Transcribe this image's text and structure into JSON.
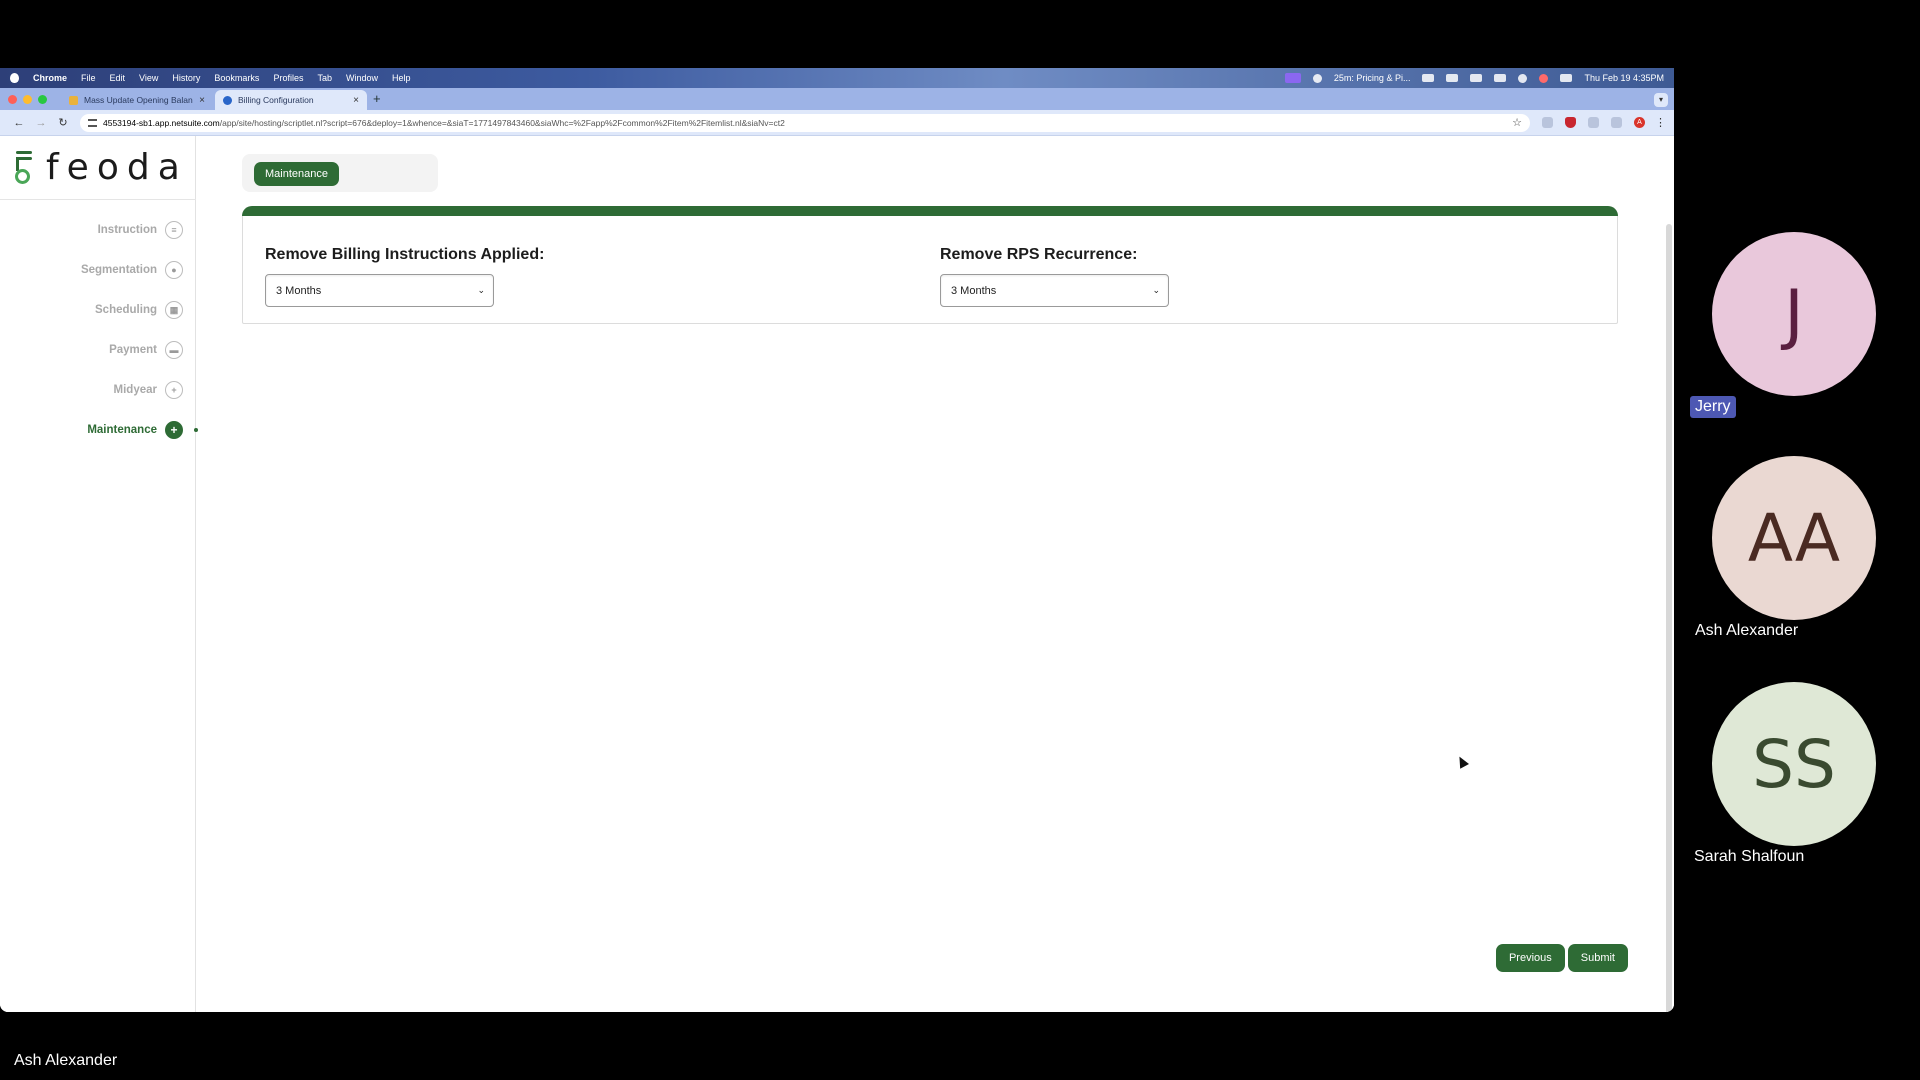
{
  "menubar": {
    "app": "Chrome",
    "items": [
      "File",
      "Edit",
      "View",
      "History",
      "Bookmarks",
      "Profiles",
      "Tab",
      "Window",
      "Help"
    ],
    "status_item": "25m: Pricing & Pi...",
    "clock": "Thu Feb 19  4:35PM"
  },
  "tabs": [
    {
      "label": "Mass Update Opening Balanc",
      "close": "×"
    },
    {
      "label": "Billing Configuration",
      "close": "×"
    }
  ],
  "new_tab": "+",
  "address": {
    "host": "4553194-sb1.app.netsuite.com",
    "path": "/app/site/hosting/scriptlet.nl?script=676&deploy=1&whence=&siaT=1771497843460&siaWhc=%2Fapp%2Fcommon%2Fitem%2Fitemlist.nl&siaNv=ct2"
  },
  "brand": {
    "logo_text": "feoda",
    "accent": "#2e6b35"
  },
  "sidebar": {
    "steps": [
      {
        "label": "Instruction",
        "icon": "list-icon",
        "glyph": "≡"
      },
      {
        "label": "Segmentation",
        "icon": "user-icon",
        "glyph": "●"
      },
      {
        "label": "Scheduling",
        "icon": "calendar-icon",
        "glyph": "▦"
      },
      {
        "label": "Payment",
        "icon": "card-icon",
        "glyph": "▬"
      },
      {
        "label": "Midyear",
        "icon": "plus-icon",
        "glyph": "+"
      },
      {
        "label": "Maintenance",
        "icon": "plus-icon",
        "glyph": "+",
        "active": true
      }
    ]
  },
  "main": {
    "section_pill": "Maintenance",
    "fields": [
      {
        "label": "Remove Billing Instructions Applied:",
        "value": "3 Months"
      },
      {
        "label": "Remove RPS Recurrence:",
        "value": "3 Months"
      }
    ],
    "buttons": {
      "previous": "Previous",
      "submit": "Submit"
    }
  },
  "participants": [
    {
      "initials": "J",
      "name": "Jerry",
      "bg": "#e9c8db",
      "fg": "#5a1f40"
    },
    {
      "initials": "AA",
      "name": "Ash Alexander",
      "bg": "#ead8d2",
      "fg": "#4a2a22"
    },
    {
      "initials": "SS",
      "name": "Sarah Shalfoun",
      "bg": "#dfe8d6",
      "fg": "#3a4a30"
    }
  ],
  "self_view_name": "Ash Alexander"
}
